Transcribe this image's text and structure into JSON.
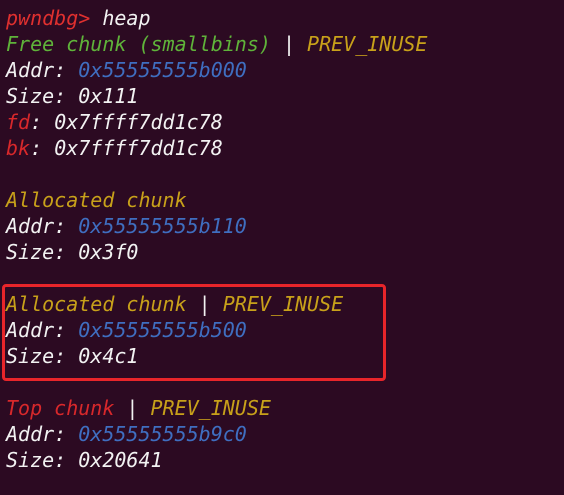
{
  "colors": {
    "background": "#2c0a22",
    "prompt": "#e0302f",
    "free_chunk": "#5fb33a",
    "flag": "#c8a11a",
    "address": "#3f6ec0",
    "pointer_label": "#d8282b",
    "highlight_box": "#e8252a"
  },
  "prompt": {
    "name": "pwndbg>",
    "command": "heap"
  },
  "chunks": [
    {
      "title": "Free chunk (smallbins)",
      "separator": "|",
      "flag": "PREV_INUSE",
      "addr_label": "Addr:",
      "addr": "0x55555555b000",
      "size_label": "Size:",
      "size": "0x111",
      "fd_label": "fd",
      "fd": "0x7ffff7dd1c78",
      "bk_label": "bk",
      "bk": "0x7ffff7dd1c78"
    },
    {
      "title": "Allocated chunk",
      "addr_label": "Addr:",
      "addr": "0x55555555b110",
      "size_label": "Size:",
      "size": "0x3f0"
    },
    {
      "title": "Allocated chunk",
      "separator": "|",
      "flag": "PREV_INUSE",
      "addr_label": "Addr:",
      "addr": "0x55555555b500",
      "size_label": "Size:",
      "size": "0x4c1"
    },
    {
      "title": "Top chunk",
      "separator": "|",
      "flag": "PREV_INUSE",
      "addr_label": "Addr:",
      "addr": "0x55555555b9c0",
      "size_label": "Size:",
      "size": "0x20641"
    }
  ],
  "colon": ":"
}
